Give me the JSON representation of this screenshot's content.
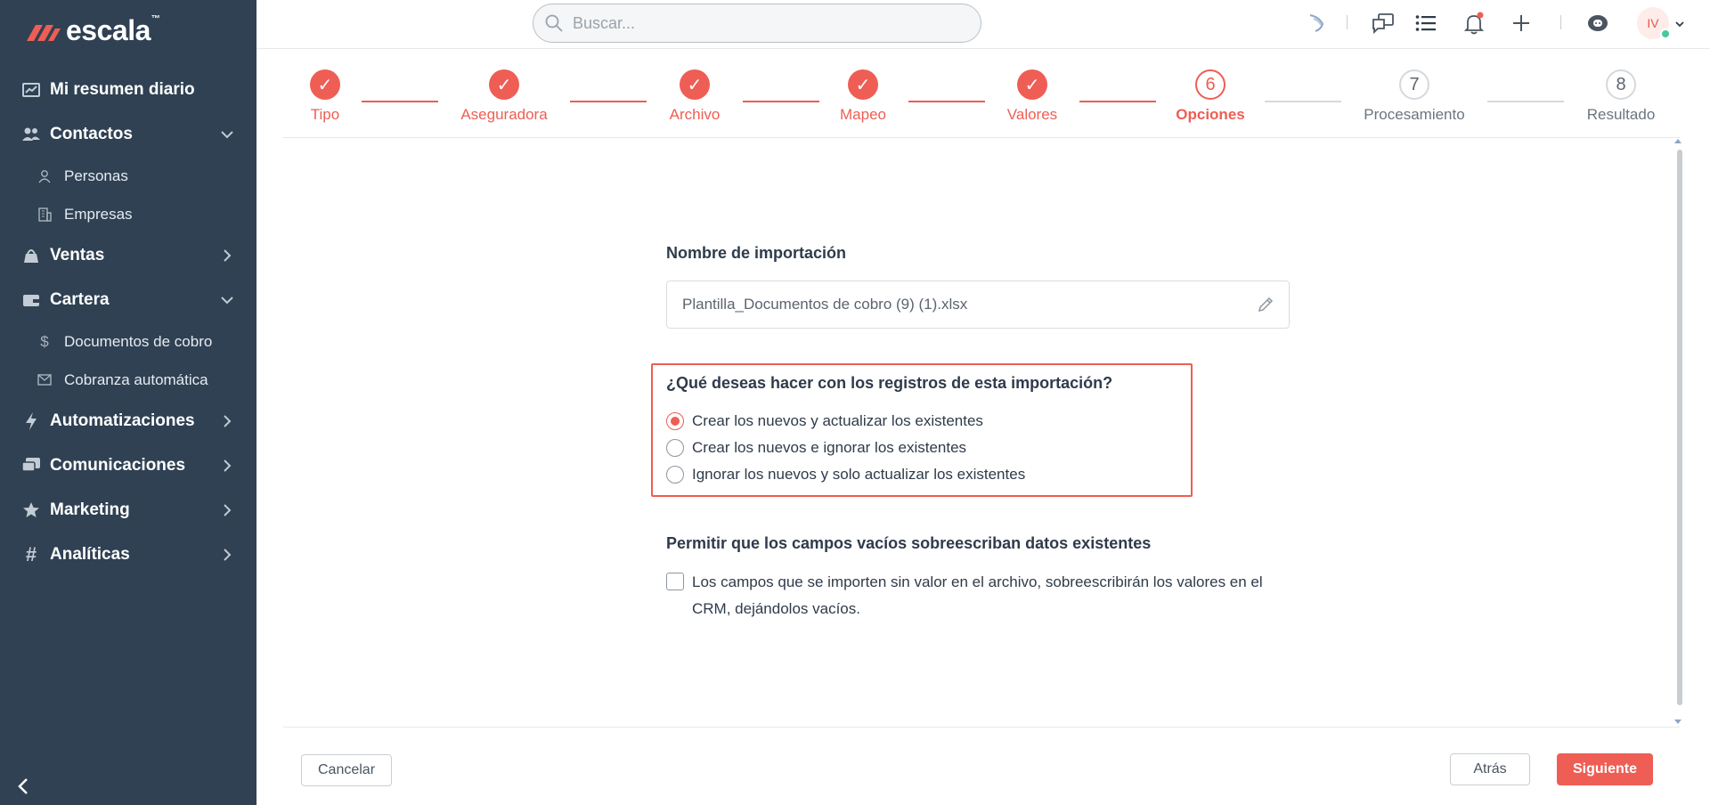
{
  "colors": {
    "sidebar_bg": "#2f4153",
    "accent": "#ee5e54",
    "pending": "#d4d9de",
    "online": "#47c7a0"
  },
  "brand": {
    "name": "escala",
    "tm": "™"
  },
  "sidebar": {
    "items": [
      {
        "label": "Mi resumen diario",
        "icon": "chart-icon"
      },
      {
        "label": "Contactos",
        "icon": "users-icon",
        "expanded": true,
        "children": [
          {
            "label": "Personas",
            "icon": "user-icon"
          },
          {
            "label": "Empresas",
            "icon": "building-icon"
          }
        ]
      },
      {
        "label": "Ventas",
        "icon": "bank-icon",
        "expanded": false
      },
      {
        "label": "Cartera",
        "icon": "wallet-icon",
        "expanded": true,
        "children": [
          {
            "label": "Documentos de cobro",
            "icon": "dollar-icon"
          },
          {
            "label": "Cobranza automática",
            "icon": "envelope-icon"
          }
        ]
      },
      {
        "label": "Automatizaciones",
        "icon": "bolt-icon",
        "expanded": false
      },
      {
        "label": "Comunicaciones",
        "icon": "chat-icon",
        "expanded": false
      },
      {
        "label": "Marketing",
        "icon": "star-icon",
        "expanded": false
      },
      {
        "label": "Analíticas",
        "icon": "hash-icon",
        "expanded": false
      }
    ]
  },
  "header": {
    "search_placeholder": "Buscar...",
    "user_initials": "IV"
  },
  "stepper": {
    "steps": [
      {
        "number": "1",
        "label": "Tipo",
        "state": "done"
      },
      {
        "number": "2",
        "label": "Aseguradora",
        "state": "done"
      },
      {
        "number": "3",
        "label": "Archivo",
        "state": "done"
      },
      {
        "number": "4",
        "label": "Mapeo",
        "state": "done"
      },
      {
        "number": "5",
        "label": "Valores",
        "state": "done"
      },
      {
        "number": "6",
        "label": "Opciones",
        "state": "active"
      },
      {
        "number": "7",
        "label": "Procesamiento",
        "state": "pending"
      },
      {
        "number": "8",
        "label": "Resultado",
        "state": "pending"
      }
    ],
    "check_glyph": "✓"
  },
  "form": {
    "import_name": {
      "title": "Nombre de importación",
      "value": "Plantilla_Documentos de cobro (9) (1).xlsx"
    },
    "records": {
      "title": "¿Qué deseas hacer con los registros de esta importación?",
      "options": [
        {
          "label": "Crear los nuevos y actualizar los existentes",
          "checked": true
        },
        {
          "label": "Crear los nuevos e ignorar los existentes",
          "checked": false
        },
        {
          "label": "Ignorar los nuevos y solo actualizar los existentes",
          "checked": false
        }
      ]
    },
    "overwrite": {
      "title": "Permitir que los campos vacíos sobreescriban datos existentes",
      "description": "Los campos que se importen sin valor en el archivo, sobreescribirán los valores en el CRM, dejándolos vacíos.",
      "checked": false
    }
  },
  "footer": {
    "cancel_label": "Cancelar",
    "back_label": "Atrás",
    "next_label": "Siguiente"
  }
}
